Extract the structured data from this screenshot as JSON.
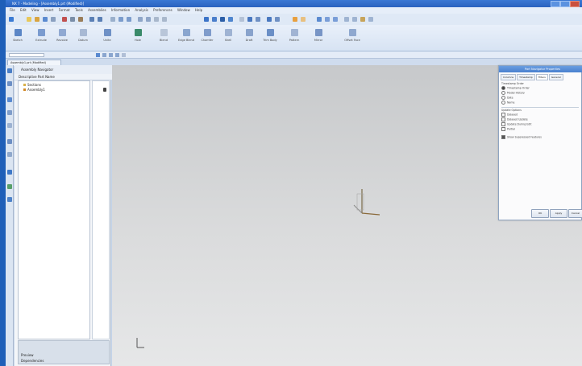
{
  "window": {
    "title": "NX 7 - Modeling - [Assembly1.prt (Modified)]"
  },
  "menubar": {
    "items": [
      "File",
      "Edit",
      "View",
      "Insert",
      "Format",
      "Tools",
      "Assemblies",
      "Information",
      "Analysis",
      "Preferences",
      "Window",
      "Help"
    ]
  },
  "ribbon": {
    "buttons": [
      "Sketch",
      "Extrude",
      "Revolve",
      "Datum",
      "Unite",
      "Hole",
      "Blend",
      "Edge Blend",
      "Chamfer",
      "Shell",
      "Draft",
      "Trim Body",
      "Pattern",
      "Mirror",
      "Offset Face"
    ]
  },
  "navigator": {
    "header": "Assembly Navigator",
    "column_header": "Descriptive Part Name",
    "nodes": [
      "Sections",
      "Assembly1"
    ],
    "details": [
      "Preview",
      "Dependencies"
    ]
  },
  "tab": {
    "label": "Assembly1.prt (Modified)"
  },
  "dialog": {
    "title": "Part Navigator Properties",
    "tabs": [
      "Columns",
      "Timestamp",
      "Filters",
      "General"
    ],
    "section1": "Timestamp Order",
    "options": [
      "Timestamp Order",
      "Model History",
      "Date",
      "Name"
    ],
    "section2": "Update Options",
    "disabled_options": [
      "Delayed",
      "Delayed Update",
      "Update During Edit",
      "Partial"
    ],
    "checkbox_label": "Show Suppressed Features",
    "ok": "OK",
    "apply": "Apply",
    "cancel": "Cancel"
  },
  "colors": {
    "desktop": "#1f5fb8",
    "title_bar": "#2a62bf",
    "graphics_bg": "#d6d7d8"
  }
}
